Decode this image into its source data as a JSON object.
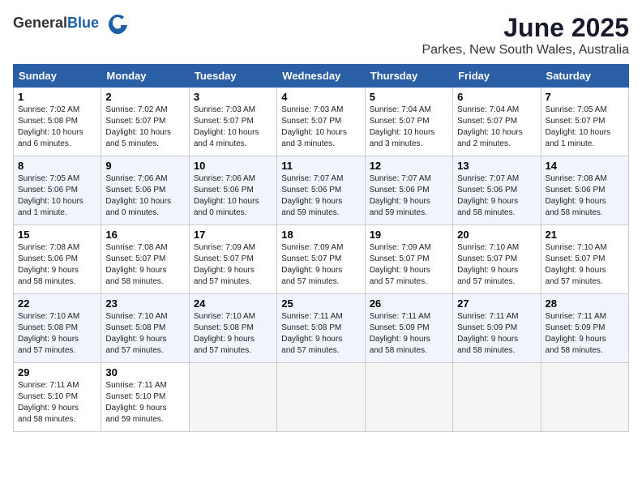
{
  "header": {
    "logo_general": "General",
    "logo_blue": "Blue",
    "month": "June 2025",
    "location": "Parkes, New South Wales, Australia"
  },
  "weekdays": [
    "Sunday",
    "Monday",
    "Tuesday",
    "Wednesday",
    "Thursday",
    "Friday",
    "Saturday"
  ],
  "weeks": [
    [
      {
        "day": "1",
        "info": "Sunrise: 7:02 AM\nSunset: 5:08 PM\nDaylight: 10 hours\nand 6 minutes."
      },
      {
        "day": "2",
        "info": "Sunrise: 7:02 AM\nSunset: 5:07 PM\nDaylight: 10 hours\nand 5 minutes."
      },
      {
        "day": "3",
        "info": "Sunrise: 7:03 AM\nSunset: 5:07 PM\nDaylight: 10 hours\nand 4 minutes."
      },
      {
        "day": "4",
        "info": "Sunrise: 7:03 AM\nSunset: 5:07 PM\nDaylight: 10 hours\nand 3 minutes."
      },
      {
        "day": "5",
        "info": "Sunrise: 7:04 AM\nSunset: 5:07 PM\nDaylight: 10 hours\nand 3 minutes."
      },
      {
        "day": "6",
        "info": "Sunrise: 7:04 AM\nSunset: 5:07 PM\nDaylight: 10 hours\nand 2 minutes."
      },
      {
        "day": "7",
        "info": "Sunrise: 7:05 AM\nSunset: 5:07 PM\nDaylight: 10 hours\nand 1 minute."
      }
    ],
    [
      {
        "day": "8",
        "info": "Sunrise: 7:05 AM\nSunset: 5:06 PM\nDaylight: 10 hours\nand 1 minute."
      },
      {
        "day": "9",
        "info": "Sunrise: 7:06 AM\nSunset: 5:06 PM\nDaylight: 10 hours\nand 0 minutes."
      },
      {
        "day": "10",
        "info": "Sunrise: 7:06 AM\nSunset: 5:06 PM\nDaylight: 10 hours\nand 0 minutes."
      },
      {
        "day": "11",
        "info": "Sunrise: 7:07 AM\nSunset: 5:06 PM\nDaylight: 9 hours\nand 59 minutes."
      },
      {
        "day": "12",
        "info": "Sunrise: 7:07 AM\nSunset: 5:06 PM\nDaylight: 9 hours\nand 59 minutes."
      },
      {
        "day": "13",
        "info": "Sunrise: 7:07 AM\nSunset: 5:06 PM\nDaylight: 9 hours\nand 58 minutes."
      },
      {
        "day": "14",
        "info": "Sunrise: 7:08 AM\nSunset: 5:06 PM\nDaylight: 9 hours\nand 58 minutes."
      }
    ],
    [
      {
        "day": "15",
        "info": "Sunrise: 7:08 AM\nSunset: 5:06 PM\nDaylight: 9 hours\nand 58 minutes."
      },
      {
        "day": "16",
        "info": "Sunrise: 7:08 AM\nSunset: 5:07 PM\nDaylight: 9 hours\nand 58 minutes."
      },
      {
        "day": "17",
        "info": "Sunrise: 7:09 AM\nSunset: 5:07 PM\nDaylight: 9 hours\nand 57 minutes."
      },
      {
        "day": "18",
        "info": "Sunrise: 7:09 AM\nSunset: 5:07 PM\nDaylight: 9 hours\nand 57 minutes."
      },
      {
        "day": "19",
        "info": "Sunrise: 7:09 AM\nSunset: 5:07 PM\nDaylight: 9 hours\nand 57 minutes."
      },
      {
        "day": "20",
        "info": "Sunrise: 7:10 AM\nSunset: 5:07 PM\nDaylight: 9 hours\nand 57 minutes."
      },
      {
        "day": "21",
        "info": "Sunrise: 7:10 AM\nSunset: 5:07 PM\nDaylight: 9 hours\nand 57 minutes."
      }
    ],
    [
      {
        "day": "22",
        "info": "Sunrise: 7:10 AM\nSunset: 5:08 PM\nDaylight: 9 hours\nand 57 minutes."
      },
      {
        "day": "23",
        "info": "Sunrise: 7:10 AM\nSunset: 5:08 PM\nDaylight: 9 hours\nand 57 minutes."
      },
      {
        "day": "24",
        "info": "Sunrise: 7:10 AM\nSunset: 5:08 PM\nDaylight: 9 hours\nand 57 minutes."
      },
      {
        "day": "25",
        "info": "Sunrise: 7:11 AM\nSunset: 5:08 PM\nDaylight: 9 hours\nand 57 minutes."
      },
      {
        "day": "26",
        "info": "Sunrise: 7:11 AM\nSunset: 5:09 PM\nDaylight: 9 hours\nand 58 minutes."
      },
      {
        "day": "27",
        "info": "Sunrise: 7:11 AM\nSunset: 5:09 PM\nDaylight: 9 hours\nand 58 minutes."
      },
      {
        "day": "28",
        "info": "Sunrise: 7:11 AM\nSunset: 5:09 PM\nDaylight: 9 hours\nand 58 minutes."
      }
    ],
    [
      {
        "day": "29",
        "info": "Sunrise: 7:11 AM\nSunset: 5:10 PM\nDaylight: 9 hours\nand 58 minutes."
      },
      {
        "day": "30",
        "info": "Sunrise: 7:11 AM\nSunset: 5:10 PM\nDaylight: 9 hours\nand 59 minutes."
      },
      {
        "day": "",
        "info": ""
      },
      {
        "day": "",
        "info": ""
      },
      {
        "day": "",
        "info": ""
      },
      {
        "day": "",
        "info": ""
      },
      {
        "day": "",
        "info": ""
      }
    ]
  ]
}
